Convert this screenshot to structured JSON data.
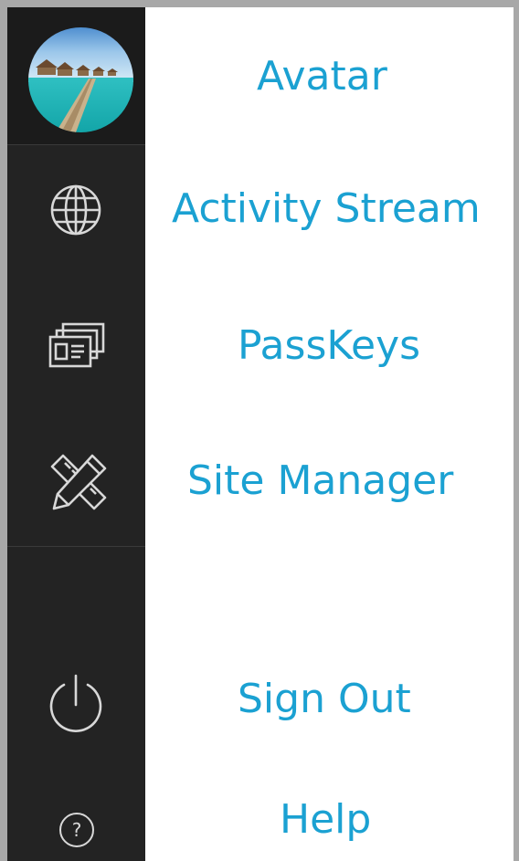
{
  "menu": {
    "items": [
      {
        "label": "Avatar",
        "icon": "avatar-photo"
      },
      {
        "label": "Activity Stream",
        "icon": "globe-icon"
      },
      {
        "label": "PassKeys",
        "icon": "cards-icon"
      },
      {
        "label": "Site Manager",
        "icon": "pencil-ruler-icon"
      },
      {
        "label": "Sign Out",
        "icon": "power-icon"
      },
      {
        "label": "Help",
        "icon": "help-icon"
      }
    ]
  },
  "help_icon_glyph": "?",
  "colors": {
    "label": "#1ba1d2",
    "rail": "#232323",
    "rail_top": "#1b1b1b",
    "icon_stroke": "#d8d8d8",
    "frame": "#a8a8a8"
  }
}
